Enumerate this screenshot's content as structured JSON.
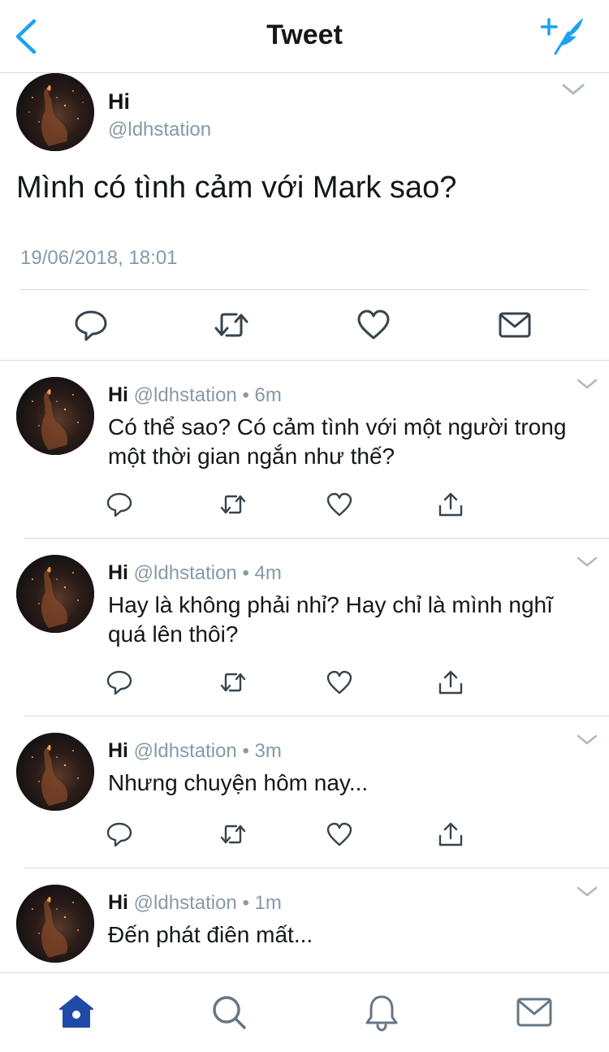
{
  "nav": {
    "title": "Tweet",
    "back_icon": "chevron-left-icon",
    "compose_icon": "compose-tweet-icon",
    "accent": "#1da1f2"
  },
  "tweet": {
    "name": "Hi",
    "handle": "@ldhstation",
    "text": "Mình có tình cảm với Mark sao?",
    "timestamp": "19/06/2018, 18:01",
    "actions": [
      "reply-icon",
      "retweet-icon",
      "like-icon",
      "message-icon"
    ]
  },
  "replies": [
    {
      "name": "Hi",
      "meta": "@ldhstation • 6m",
      "text": "Có thể sao? Có cảm tình với một người trong một thời gian ngắn như thế?"
    },
    {
      "name": "Hi",
      "meta": "@ldhstation • 4m",
      "text": "Hay là không phải nhỉ? Hay chỉ là mình nghĩ quá lên thôi?"
    },
    {
      "name": "Hi",
      "meta": "@ldhstation • 3m",
      "text": "Nhưng chuyện hôm nay..."
    },
    {
      "name": "Hi",
      "meta": "@ldhstation • 1m",
      "text": "Đến phát điên mất..."
    }
  ],
  "tabbar": {
    "items": [
      "home-icon",
      "search-icon",
      "notifications-icon",
      "messages-icon"
    ],
    "active": "home-icon",
    "active_color": "#1f4aa8",
    "inactive_color": "#657786"
  }
}
